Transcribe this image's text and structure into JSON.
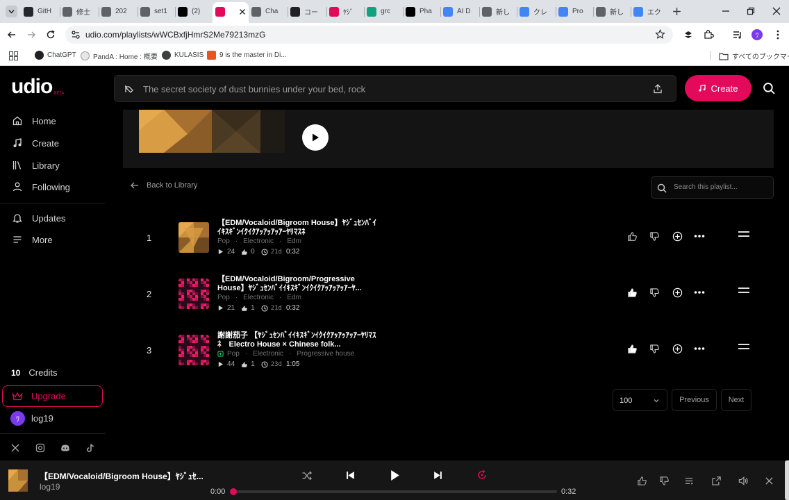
{
  "browser": {
    "tabs": [
      {
        "title": "GitH",
        "icon": "github-icon",
        "color": "#24292f"
      },
      {
        "title": "修士",
        "icon": "globe-icon",
        "color": "#5f6368"
      },
      {
        "title": "202",
        "icon": "globe-icon",
        "color": "#5f6368"
      },
      {
        "title": "set1",
        "icon": "globe-icon",
        "color": "#5f6368"
      },
      {
        "title": "(2) ",
        "icon": "x-icon",
        "color": "#000000"
      },
      {
        "title": "",
        "icon": "udio-icon",
        "color": "#e30a5c",
        "active": true
      },
      {
        "title": "Cha",
        "icon": "page-icon",
        "color": "#5f6368"
      },
      {
        "title": "コー",
        "icon": "dark-circle-icon",
        "color": "#202124"
      },
      {
        "title": "ﾔｼﾞ",
        "icon": "udio-icon",
        "color": "#e30a5c"
      },
      {
        "title": "grc",
        "icon": "chatgpt-icon",
        "color": "#10a37f"
      },
      {
        "title": "Pha",
        "icon": "wikipedia-icon",
        "color": "#000000"
      },
      {
        "title": "AI D",
        "icon": "google-icon",
        "color": "#4285f4"
      },
      {
        "title": "新し",
        "icon": "globe-icon",
        "color": "#5f6368"
      },
      {
        "title": "クレ",
        "icon": "google-icon",
        "color": "#4285f4"
      },
      {
        "title": "Pro",
        "icon": "google-icon",
        "color": "#4285f4"
      },
      {
        "title": "新し",
        "icon": "globe-icon",
        "color": "#5f6368"
      },
      {
        "title": "エク",
        "icon": "google-icon",
        "color": "#4285f4"
      }
    ],
    "url": "udio.com/playlists/wWCBxfjHmrS2Me79213mzG",
    "bookmarks": [
      {
        "label": "ChatGPT",
        "icon": "chatgpt-icon"
      },
      {
        "label": "PandA : Home : 概要",
        "icon": "panda-icon"
      },
      {
        "label": "KULASIS",
        "icon": "globe-icon"
      },
      {
        "label": "9 is the master in Di...",
        "icon": "flag-icon"
      }
    ],
    "all_bookmarks": "すべてのブックマーク",
    "profile_initial": "ﾜ"
  },
  "app": {
    "logo": "udio",
    "logo_badge": "BETA",
    "nav": [
      {
        "label": "Home",
        "icon": "home-icon"
      },
      {
        "label": "Create",
        "icon": "music-note-icon"
      },
      {
        "label": "Library",
        "icon": "library-icon"
      },
      {
        "label": "Following",
        "icon": "person-icon"
      },
      {
        "label": "Updates",
        "icon": "bell-icon"
      },
      {
        "label": "More",
        "icon": "menu-icon"
      }
    ],
    "credits_count": "10",
    "credits_label": "Credits",
    "upgrade_label": "Upgrade",
    "user_name": "log19",
    "user_initial": "ﾜ",
    "social": [
      "x-icon",
      "instagram-icon",
      "discord-icon",
      "tiktok-icon"
    ],
    "search_placeholder": "The secret society of dust bunnies under your bed,  rock",
    "create_label": "Create",
    "back_label": "Back to Library",
    "playlist_search_placeholder": "Search this playlist...",
    "tracks": [
      {
        "index": "1",
        "title": "【EDM/Vocaloid/Bigroom House】ﾔｼﾞｭｾﾝﾊﾞｲｲｷｽｷﾞﾝｲｸｲｸｱｯｱｯｱｯｱｰﾔﾘﾏｽﾈ",
        "tags": [
          "Pop",
          "Electronic",
          "Edm"
        ],
        "plays": "24",
        "likes": "0",
        "age": "21d",
        "duration": "0:32",
        "liked": false,
        "art": "gold"
      },
      {
        "index": "2",
        "title": "【EDM/Vocaloid/Bigroom/Progressive House】ﾔｼﾞｭｾﾝﾊﾞｲｲｷｽｷﾞﾝｲｸｲｸｱｯｱｯｱｯｱｰﾔ...",
        "tags": [
          "Pop",
          "Electronic",
          "Edm"
        ],
        "plays": "21",
        "likes": "1",
        "age": "21d",
        "duration": "0:32",
        "liked": true,
        "art": "pink"
      },
      {
        "index": "3",
        "title": "謝謝茄子 【ﾔｼﾞｭｾﾝﾊﾞｲｲｷｽｷﾞﾝｲｸｲｸｱｯｱｯｱｯｱｰﾔﾘﾏｽﾈ　Electro House × Chinese folk...",
        "tags": [
          "Pop",
          "Electronic",
          "Progressive house"
        ],
        "plays": "44",
        "likes": "1",
        "age": "23d",
        "duration": "1:05",
        "liked": true,
        "art": "pink",
        "tag_icon": true
      }
    ],
    "per_page": "100",
    "previous_label": "Previous",
    "next_label": "Next"
  },
  "player": {
    "title": "【EDM/Vocaloid/Bigroom House】ﾔｼﾞｭｾ...",
    "artist": "log19",
    "current_time": "0:00",
    "total_time": "0:32",
    "progress": 0.0
  },
  "colors": {
    "accent": "#e30a5c",
    "background": "#000000",
    "avatar": "#7c3aed"
  }
}
